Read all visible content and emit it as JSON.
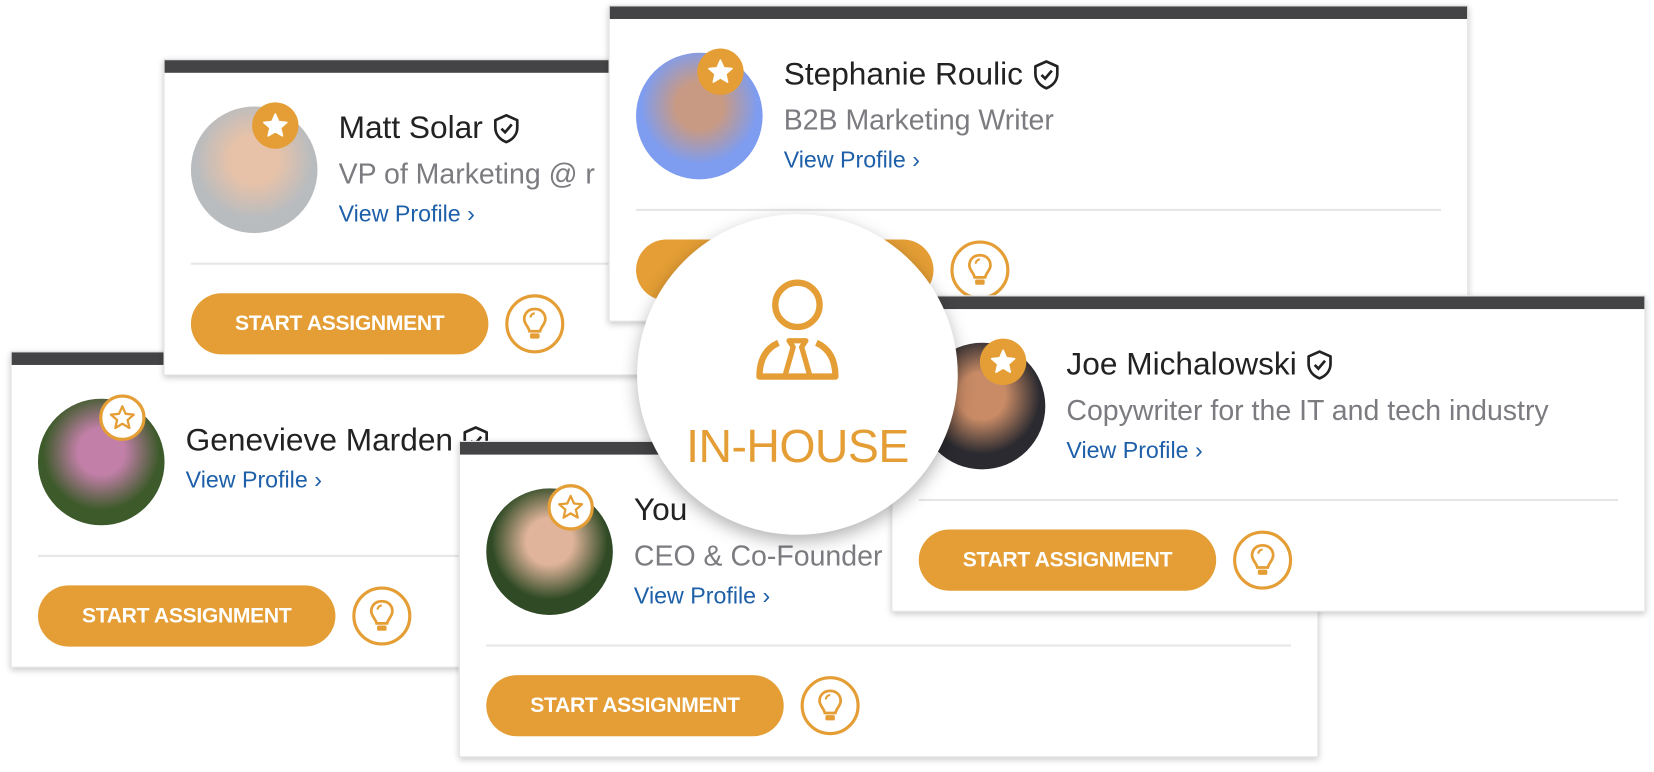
{
  "accent_color": "#E49E35",
  "link_color": "#1D5FA8",
  "badge": {
    "label": "IN-HOUSE",
    "icon": "person-with-tie-icon"
  },
  "cards": [
    {
      "id": "c-gen",
      "name": "Genevieve Marden",
      "subtitle": "",
      "link": "View Profile ›",
      "button": "START ASSIGNMENT",
      "star": "outline",
      "verified": true,
      "avatar_colors": [
        "#c27fa8",
        "#3d5a2a"
      ]
    },
    {
      "id": "c-matt",
      "name": "Matt Solar",
      "subtitle": "VP of Marketing @ r",
      "link": "View Profile ›",
      "button": "START ASSIGNMENT",
      "star": "filled",
      "verified": true,
      "avatar_colors": [
        "#e8c2a8",
        "#b9bcbf"
      ]
    },
    {
      "id": "c-steph",
      "name": "Stephanie Roulic",
      "subtitle": "B2B Marketing Writer",
      "link": "View Profile ›",
      "button": "START ASSIGNMENT",
      "star": "filled",
      "verified": true,
      "avatar_colors": [
        "#c99a83",
        "#7e9cf0"
      ]
    },
    {
      "id": "c-you",
      "name": "You",
      "subtitle": "CEO & Co-Founder",
      "link": "View Profile ›",
      "button": "START ASSIGNMENT",
      "star": "outline",
      "verified": false,
      "avatar_colors": [
        "#e0b49a",
        "#2f4a25"
      ]
    },
    {
      "id": "c-joe",
      "name": "Joe Michalowski",
      "subtitle": "Copywriter for the IT and tech industry",
      "link": "View Profile ›",
      "button": "START ASSIGNMENT",
      "star": "filled",
      "verified": true,
      "avatar_colors": [
        "#c98b66",
        "#2a2a30"
      ]
    }
  ]
}
